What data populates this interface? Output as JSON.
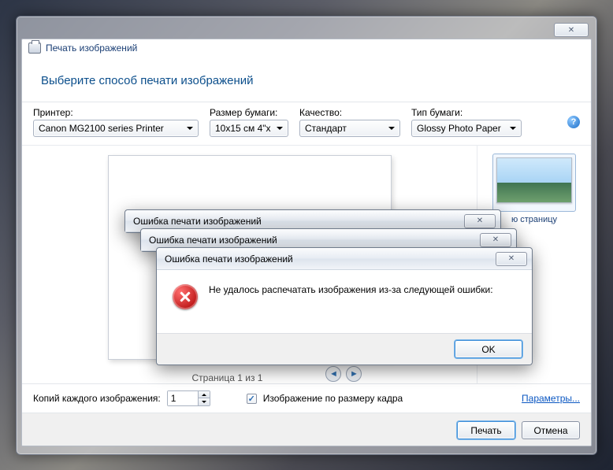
{
  "window": {
    "title": "Печать изображений",
    "close_glyph": "✕"
  },
  "subtitle": "Выберите способ печати изображений",
  "controls": {
    "printer_label": "Принтер:",
    "printer_value": "Canon MG2100 series Printer",
    "papersize_label": "Размер бумаги:",
    "papersize_value": "10x15 см 4\"x",
    "quality_label": "Качество:",
    "quality_value": "Стандарт",
    "papertype_label": "Тип бумаги:",
    "papertype_value": "Glossy Photo Paper"
  },
  "side": {
    "thumb_label": "ю страницу"
  },
  "preview": {
    "caption": "Страница 1 из 1"
  },
  "bottom": {
    "copies_label": "Копий каждого изображения:",
    "copies_value": "1",
    "fit_checked": true,
    "fit_label": "Изображение по размеру кадра",
    "params_link": "Параметры..."
  },
  "actions": {
    "print": "Печать",
    "cancel": "Отмена"
  },
  "error_dialogs": {
    "title": "Ошибка печати изображений",
    "message": "Не удалось распечатать изображения из-за следующей ошибки:",
    "ok": "OK",
    "close_glyph": "✕"
  }
}
